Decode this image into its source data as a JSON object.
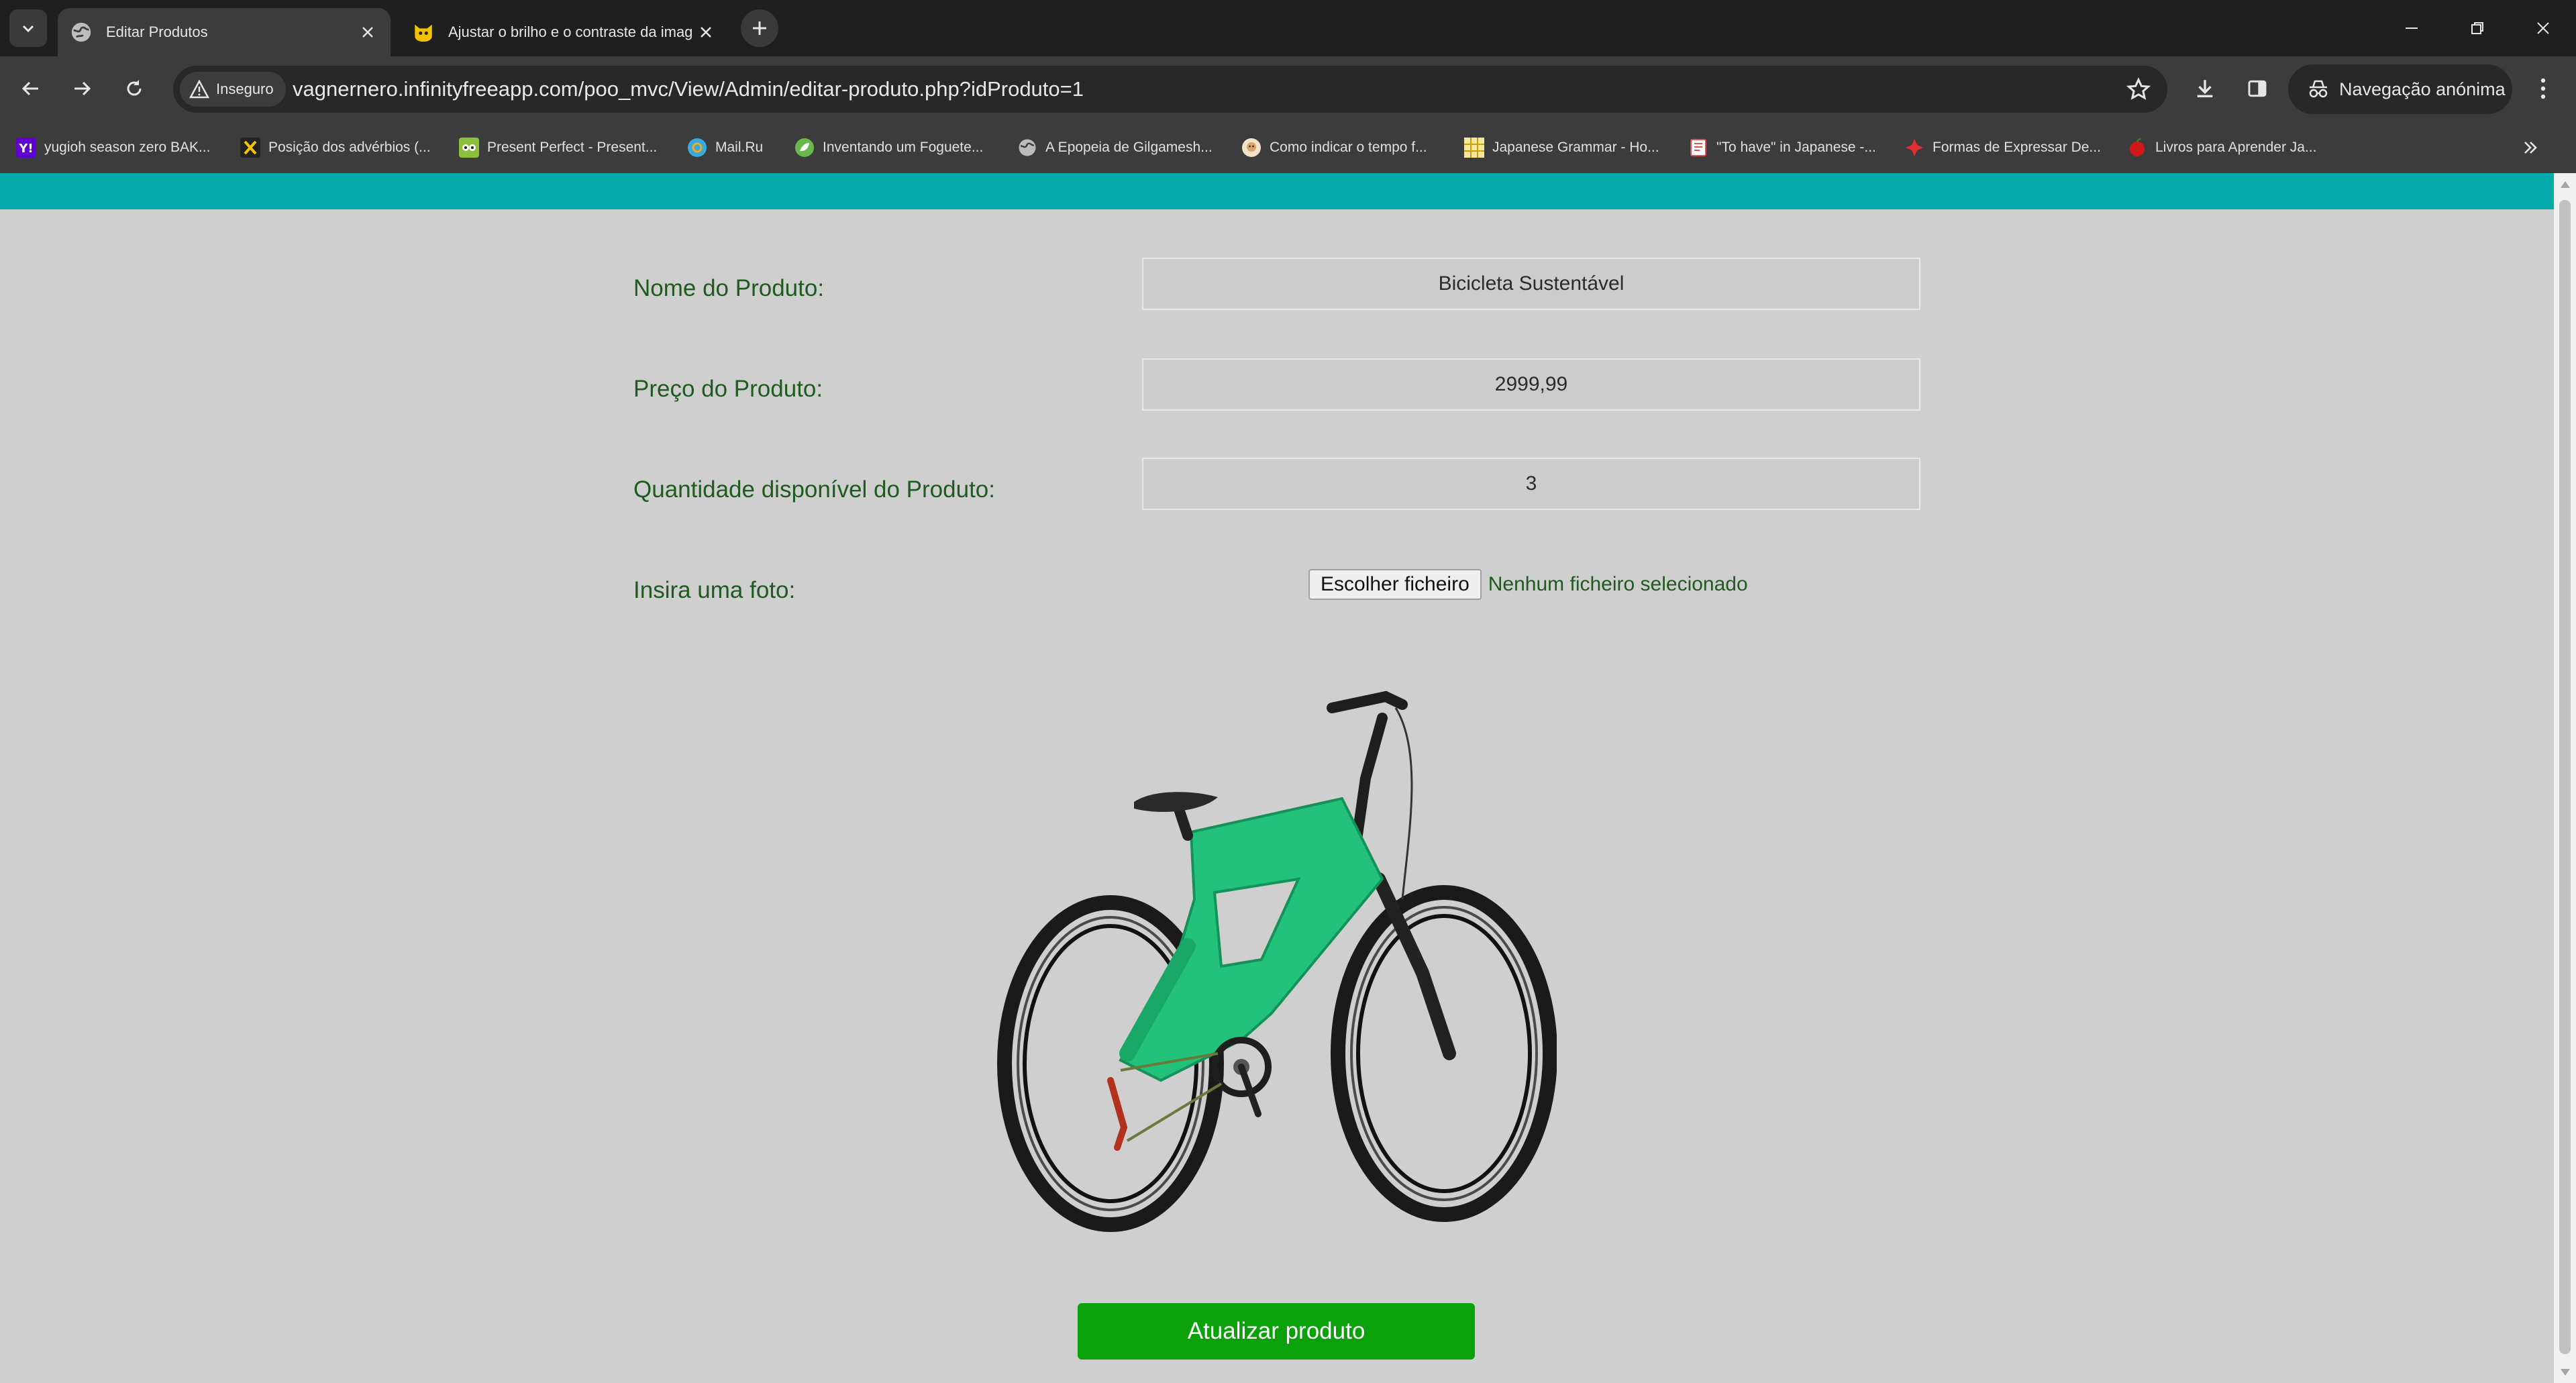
{
  "browser": {
    "tabs": [
      {
        "title": "Editar Produtos",
        "icon": "globe-icon",
        "active": true
      },
      {
        "title": "Ajustar o brilho e o contraste da imag",
        "icon": "cat-icon",
        "active": false
      }
    ],
    "address": {
      "security_label": "Inseguro",
      "url": "vagnernero.infinityfreeapp.com/poo_mvc/View/Admin/editar-produto.php?idProduto=1"
    },
    "profile_label": "Navegação anónima",
    "bookmarks": [
      {
        "label": "yugioh season zero BAK...",
        "icon": "yahoo-icon",
        "color": "#6001d2"
      },
      {
        "label": "Posição dos advérbios (...",
        "icon": "x-logo-icon",
        "color": "#f5c400"
      },
      {
        "label": "Present Perfect - Present...",
        "icon": "owl-icon",
        "color": "#8bbf3c"
      },
      {
        "label": "Mail.Ru",
        "icon": "mailru-icon",
        "color": "#39a9e0"
      },
      {
        "label": "Inventando um Foguete...",
        "icon": "leaf-icon",
        "color": "#68b84a"
      },
      {
        "label": "A Epopeia de Gilgamesh...",
        "icon": "globe-icon",
        "color": "#bbbbbb"
      },
      {
        "label": "Como indicar o tempo f...",
        "icon": "face-icon",
        "color": "#d9a26a"
      },
      {
        "label": "Japanese Grammar - Ho...",
        "icon": "grid-icon",
        "color": "#c8a000"
      },
      {
        "label": "\"To have\" in Japanese -...",
        "icon": "book-icon",
        "color": "#e05050"
      },
      {
        "label": "Formas de Expressar De...",
        "icon": "cross-icon",
        "color": "#e03030"
      },
      {
        "label": "Livros para Aprender Ja...",
        "icon": "apple-icon",
        "color": "#d01818"
      }
    ]
  },
  "colors": {
    "header_bar": "#05aaaa",
    "page_background": "#cfcfcf",
    "label_text": "#1f5a1f",
    "submit_button": "#0aa10a"
  },
  "form": {
    "name_label": "Nome do Produto:",
    "name_value": "Bicicleta Sustentável",
    "price_label": "Preço do Produto:",
    "price_value": "2999,99",
    "qty_label": "Quantidade disponível do Produto:",
    "qty_value": "3",
    "photo_label": "Insira uma foto:",
    "file_button_label": "Escolher ficheiro",
    "file_status": "Nenhum ficheiro selecionado",
    "image_alt": "bicycle-product-photo",
    "submit_label": "Atualizar produto"
  }
}
